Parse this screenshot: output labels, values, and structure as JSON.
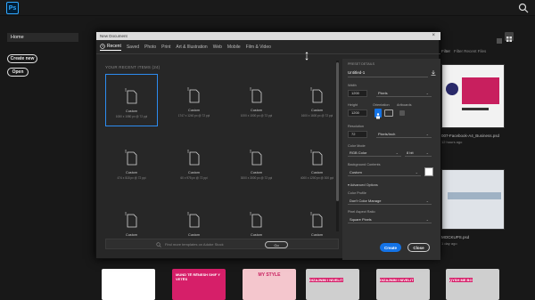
{
  "app": {
    "logo": "Ps"
  },
  "home": {
    "nav_home": "Home",
    "create_new": "Create new",
    "open": "Open",
    "filter_label": "Filter",
    "filter_placeholder": "Filter Recent Files",
    "recent_files": [
      {
        "name": "007-Facebook-A4_Business.psd",
        "time": "12 hours ago"
      },
      {
        "name": "MOCKUPS.psd",
        "time": "1 day ago"
      }
    ],
    "bottom_thumbs": [
      {
        "text": ""
      },
      {
        "text": "MUND TË RËNESH SHIF Y VETËS"
      },
      {
        "text": "MY STYLE"
      },
      {
        "text": "DIZAJNIM I NIVELIT"
      },
      {
        "text": "DIZAJNIM I NIVELIT"
      },
      {
        "text": "QYSH ME BO"
      }
    ]
  },
  "dialog": {
    "title": "New Document",
    "tabs": [
      "Recent",
      "Saved",
      "Photo",
      "Print",
      "Art & Illustration",
      "Web",
      "Mobile",
      "Film & Video"
    ],
    "recent_heading": "YOUR RECENT ITEMS  (24)",
    "cards": [
      {
        "name": "Custom",
        "dims": "1080 x 1080 px @ 72 ppi"
      },
      {
        "name": "Custom",
        "dims": "1747 x 1240 px @ 72 ppi"
      },
      {
        "name": "Custom",
        "dims": "1000 x 1000 px @ 72 ppi"
      },
      {
        "name": "Custom",
        "dims": "1600 x 1600 px @ 72 ppi"
      },
      {
        "name": "Custom",
        "dims": "474 x 518 px @ 72 ppi"
      },
      {
        "name": "Custom",
        "dims": "60 x 975 px @ 72 ppi"
      },
      {
        "name": "Custom",
        "dims": "3000 x 3000 px @ 72 ppi"
      },
      {
        "name": "Custom",
        "dims": "4000 x 1200 px @ 300 ppi"
      },
      {
        "name": "Custom",
        "dims": ""
      },
      {
        "name": "Custom",
        "dims": ""
      },
      {
        "name": "Custom",
        "dims": ""
      },
      {
        "name": "Custom",
        "dims": ""
      }
    ],
    "stock_placeholder": "Find more templates on Adobe Stock",
    "go": "Go",
    "preset": {
      "heading": "PRESET DETAILS",
      "name": "Untitled-1",
      "width_label": "Width",
      "width_value": "1200",
      "width_unit": "Pixels",
      "height_label": "Height",
      "height_value": "1200",
      "orientation_label": "Orientation",
      "artboards_label": "Artboards",
      "resolution_label": "Resolution",
      "resolution_value": "72",
      "resolution_unit": "Pixels/Inch",
      "color_mode_label": "Color Mode",
      "color_mode": "RGB Color",
      "bit_depth": "8 bit",
      "bg_label": "Background Contents",
      "bg_value": "Custom",
      "advanced": "Advanced Options",
      "profile_label": "Color Profile",
      "profile_value": "Don't Color Manage",
      "pixel_aspect_label": "Pixel Aspect Ratio",
      "pixel_aspect_value": "Square Pixels"
    },
    "create": "Create",
    "close": "Close"
  }
}
